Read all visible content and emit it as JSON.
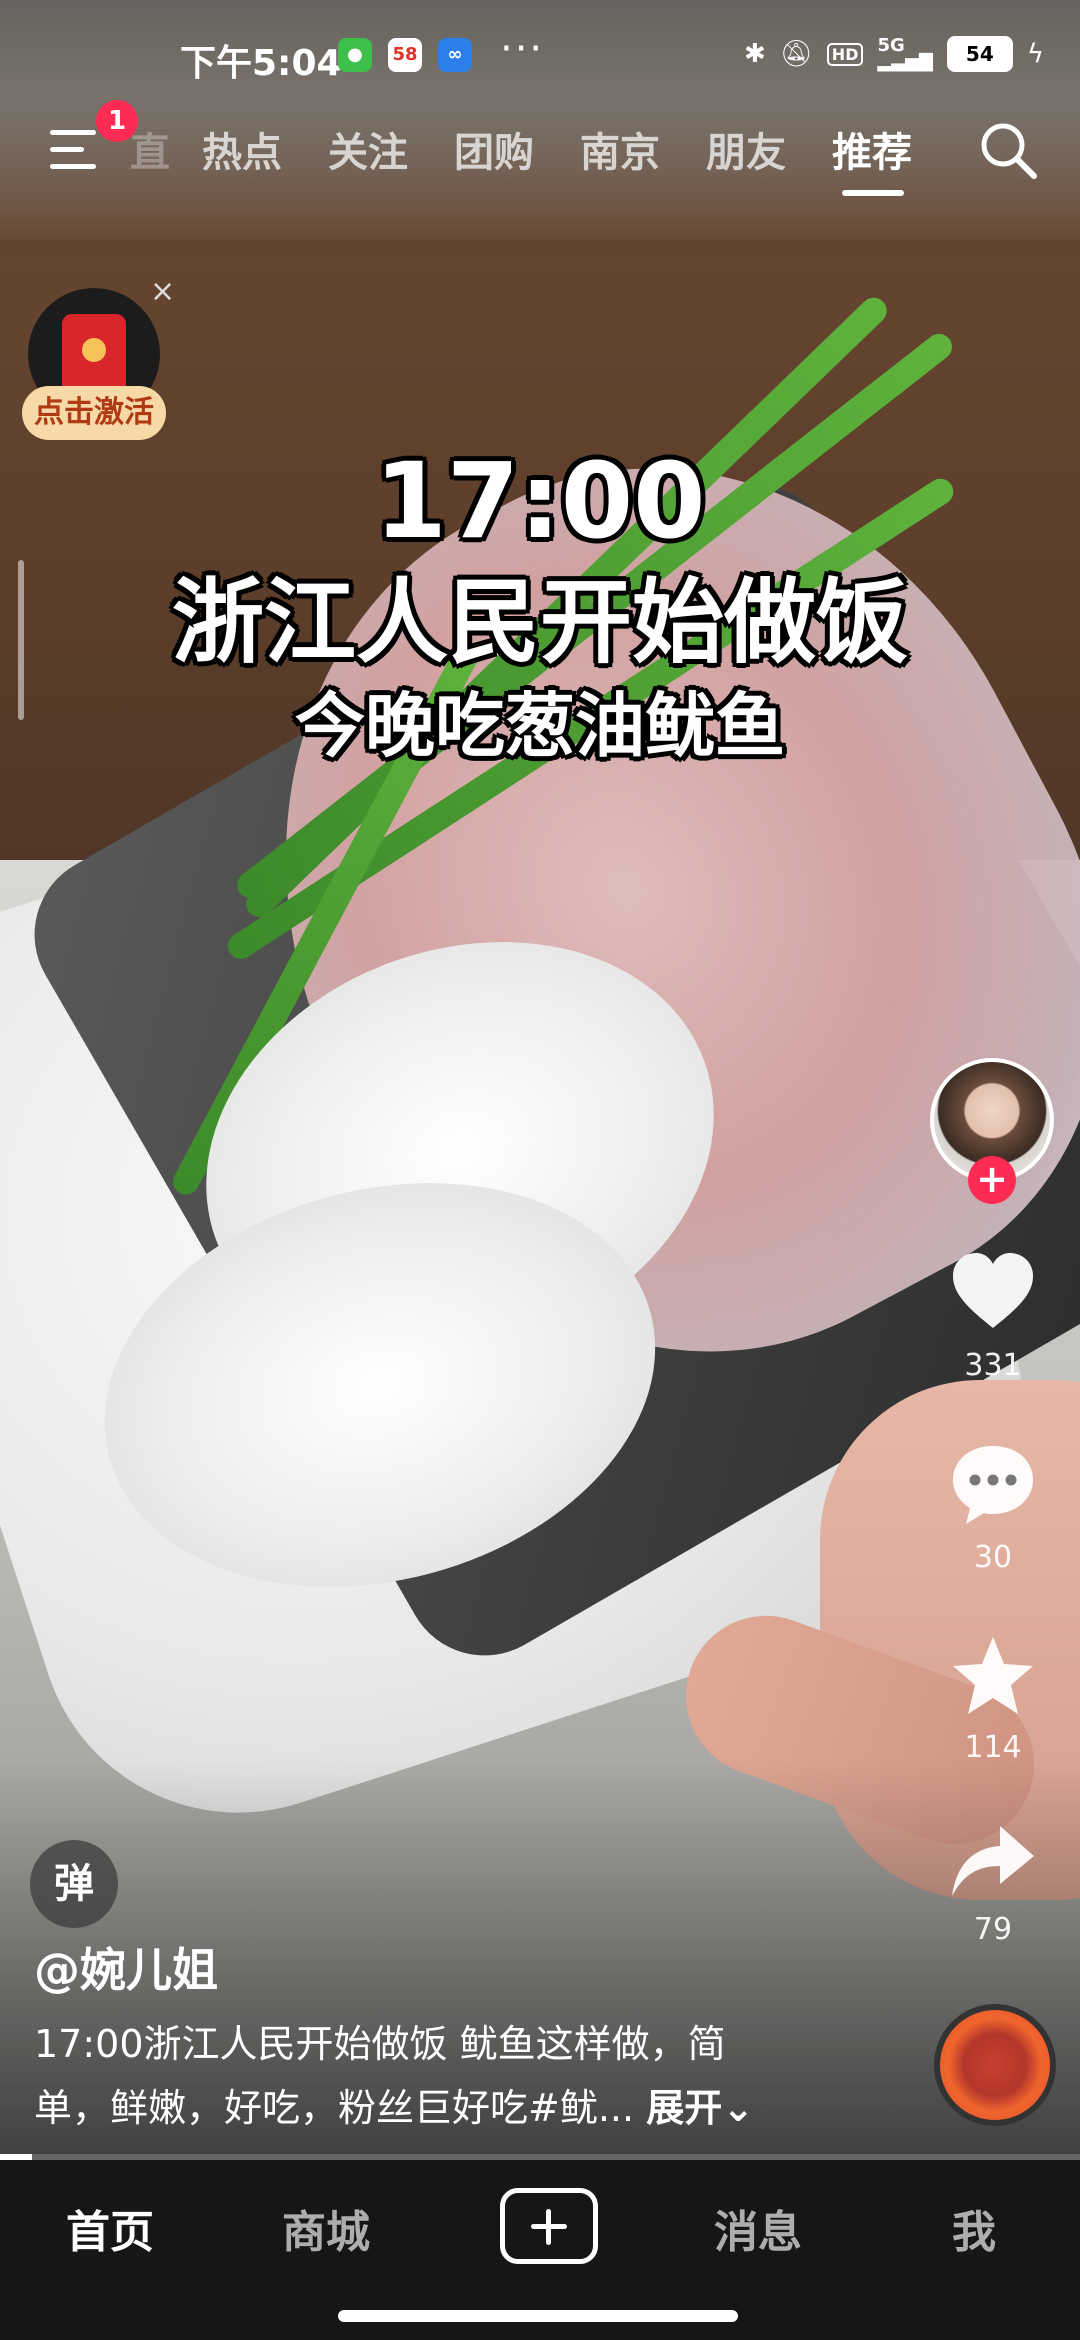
{
  "status_bar": {
    "time": "下午5:04",
    "app_icons": [
      "green-app-icon",
      "58-app-icon",
      "cloud-app-icon"
    ],
    "more": "···",
    "signal": "5G",
    "hd": "HD",
    "battery": "54"
  },
  "top_nav": {
    "notification_count": "1",
    "partial_tab": "直",
    "tabs": [
      "热点",
      "关注",
      "团购",
      "南京",
      "朋友",
      "推荐"
    ],
    "active_tab": "推荐"
  },
  "redpack": {
    "label": "点击激活",
    "close": "×"
  },
  "overlay": {
    "line1": "17:00",
    "line2": "浙江人民开始做饭",
    "line3": "今晚吃葱油鱿鱼"
  },
  "actions": {
    "follow": "+",
    "likes": "331",
    "comments": "30",
    "favorites": "114",
    "shares": "79"
  },
  "video_info": {
    "danmu": "弹",
    "author": "@婉儿姐",
    "description_line1": "17:00浙江人民开始做饭 鱿鱼这样做，简",
    "description_line2": "单，鲜嫩，好吃，粉丝巨好吃#鱿...",
    "expand": "展开",
    "progress": 0.03
  },
  "bottom_tabs": {
    "home": "首页",
    "mall": "商城",
    "messages": "消息",
    "me": "我"
  },
  "colors": {
    "accent": "#fe2c55",
    "tabbar": "#161616"
  }
}
